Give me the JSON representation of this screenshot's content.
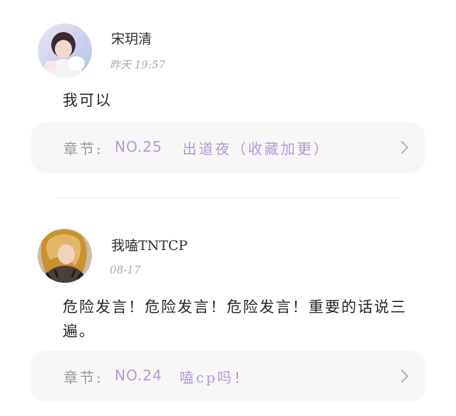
{
  "comments": [
    {
      "username": "宋玥清",
      "timestamp": "昨天 19:57",
      "text": "我可以",
      "chapter": {
        "label": "章节:",
        "number": "NO.25",
        "title": "出道夜（收藏加更）"
      }
    },
    {
      "username": "我嗑TNTCP",
      "timestamp": "08-17",
      "text": "危险发言！危险发言！危险发言！重要的话说三遍。",
      "chapter": {
        "label": "章节:",
        "number": "NO.24",
        "title": "嗑cp吗！"
      }
    }
  ],
  "colors": {
    "accent": "#b49ad6",
    "card_bg": "#f7f7f7",
    "muted_text": "#a9a9a9"
  },
  "icons": {
    "chevron": "chevron-right-icon"
  }
}
